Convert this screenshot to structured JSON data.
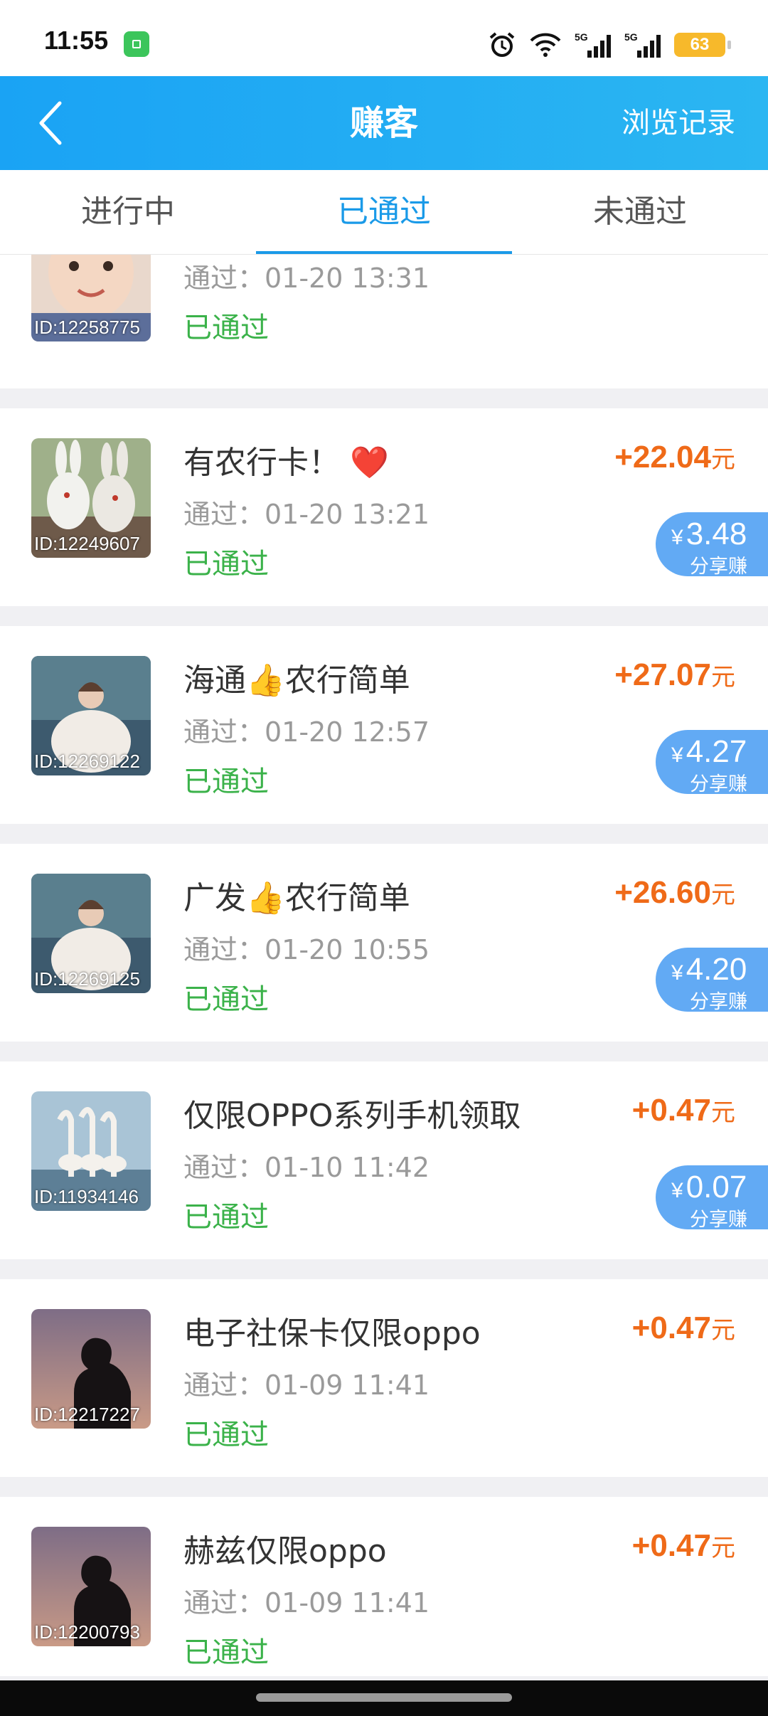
{
  "status_bar": {
    "time": "11:55",
    "battery": "63"
  },
  "header": {
    "title": "赚客",
    "history_label": "浏览记录"
  },
  "tabs": [
    {
      "label": "进行中"
    },
    {
      "label": "已通过",
      "active": true
    },
    {
      "label": "未通过"
    }
  ],
  "tasks": [
    {
      "id": "ID:12258775",
      "title": "",
      "time": "通过：01-20 13:31",
      "status": "已通过",
      "reward_amount": "",
      "reward_unit": "",
      "share_amount": "",
      "share_label": ""
    },
    {
      "id": "ID:12249607",
      "title": "有农行卡！ ❤️",
      "time": "通过：01-20 13:21",
      "status": "已通过",
      "reward_amount": "+22.04",
      "reward_unit": "元",
      "share_amount": "3.48",
      "share_label": "分享赚"
    },
    {
      "id": "ID:12269122",
      "title": "海通👍农行简单",
      "time": "通过：01-20 12:57",
      "status": "已通过",
      "reward_amount": "+27.07",
      "reward_unit": "元",
      "share_amount": "4.27",
      "share_label": "分享赚"
    },
    {
      "id": "ID:12269125",
      "title": "广发👍农行简单",
      "time": "通过：01-20 10:55",
      "status": "已通过",
      "reward_amount": "+26.60",
      "reward_unit": "元",
      "share_amount": "4.20",
      "share_label": "分享赚"
    },
    {
      "id": "ID:11934146",
      "title": "仅限OPPO系列手机领取",
      "time": "通过：01-10 11:42",
      "status": "已通过",
      "reward_amount": "+0.47",
      "reward_unit": "元",
      "share_amount": "0.07",
      "share_label": "分享赚"
    },
    {
      "id": "ID:12217227",
      "title": "电子社保卡仅限oppo",
      "time": "通过：01-09 11:41",
      "status": "已通过",
      "reward_amount": "+0.47",
      "reward_unit": "元",
      "share_amount": "",
      "share_label": ""
    },
    {
      "id": "ID:12200793",
      "title": "赫兹仅限oppo",
      "time": "通过：01-09 11:41",
      "status": "已通过",
      "reward_amount": "+0.47",
      "reward_unit": "元",
      "share_amount": "",
      "share_label": ""
    }
  ],
  "share_currency": "¥",
  "colors": {
    "header": "#1aa3f4",
    "accent": "#1a9ae8",
    "reward": "#ef6a18",
    "status_passed": "#3bb24a",
    "share_pill": "#62aaf4"
  }
}
